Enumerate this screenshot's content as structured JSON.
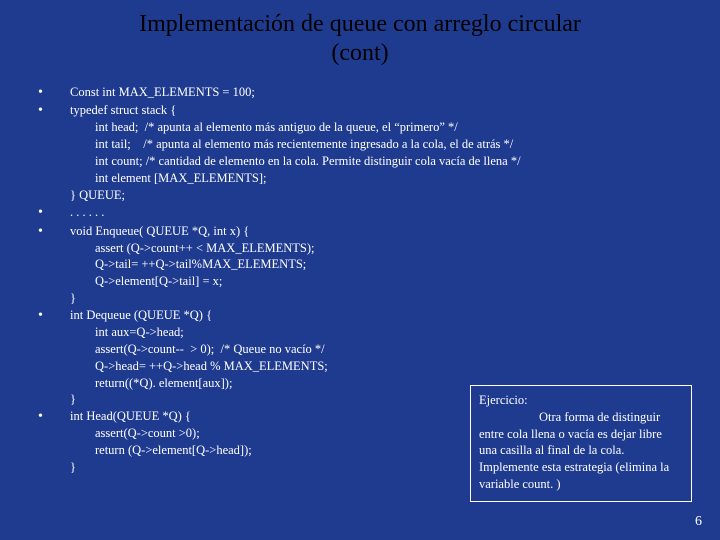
{
  "title_line1": "Implementación de queue con arreglo circular",
  "title_line2": "(cont)",
  "bullets": [
    "Const int MAX_ELEMENTS = 100;",
    "typedef struct stack {\n        int head;  /* apunta al elemento más antiguo de la queue, el “primero” */\n        int tail;    /* apunta al elemento más recientemente ingresado a la cola, el de atrás */\n        int count; /* cantidad de elemento en la cola. Permite distinguir cola vacía de llena */\n        int element [MAX_ELEMENTS];\n} QUEUE;",
    ". . . . . .",
    "void Enqueue( QUEUE *Q, int x) {\n        assert (Q->count++ < MAX_ELEMENTS);\n        Q->tail= ++Q->tail%MAX_ELEMENTS;\n        Q->element[Q->tail] = x;\n}",
    "int Dequeue (QUEUE *Q) {\n        int aux=Q->head;\n        assert(Q->count--  > 0);  /* Queue no vacío */\n        Q->head= ++Q->head % MAX_ELEMENTS;\n        return((*Q). element[aux]);\n}",
    "int Head(QUEUE *Q) {\n        assert(Q->count >0);\n        return (Q->element[Q->head]);\n}"
  ],
  "exercise": {
    "label": "Ejercicio:",
    "line2": "Otra forma de distinguir",
    "rest": "entre cola llena o vacía es dejar libre una casilla al final de la cola. Implemente esta estrategia (elimina la variable count. )"
  },
  "page_number": "6"
}
